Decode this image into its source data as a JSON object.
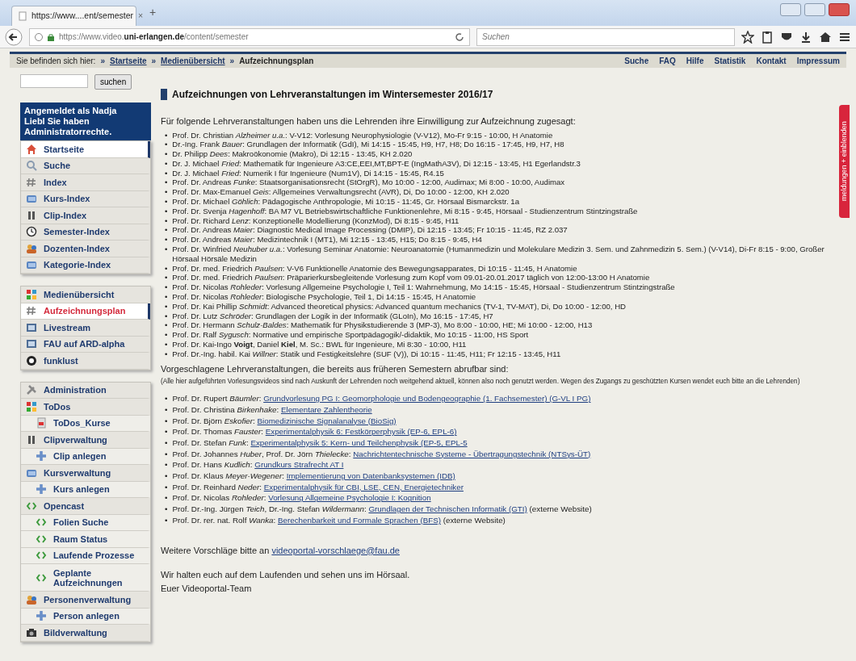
{
  "browser": {
    "tab_title": "https://www....ent/semester",
    "tab_close": "×",
    "new_tab": "+",
    "url": "https://www.video.**uni-erlangen.de**/content/semester",
    "search_placeholder": "Suchen"
  },
  "breadcrumb": {
    "prefix": "Sie befinden sich hier:",
    "items": [
      {
        "sep": "»",
        "label": "Startseite",
        "current": false
      },
      {
        "sep": "»",
        "label": "Medienübersicht",
        "current": false
      },
      {
        "sep": "»",
        "label": "Aufzeichnungsplan",
        "current": true
      }
    ]
  },
  "top_links": [
    "Suche",
    "FAQ",
    "Hilfe",
    "Statistik",
    "Kontakt",
    "Impressum"
  ],
  "sidebar": {
    "search_button": "suchen",
    "login_note": "Angemeldet als Nadja Liebl Sie haben Administratorrechte.",
    "groups": [
      [
        {
          "label": "Startseite",
          "selected": false,
          "highlighted": true
        },
        {
          "label": "Suche",
          "selected": false,
          "highlighted": false
        },
        {
          "label": "Index",
          "selected": false,
          "highlighted": false
        },
        {
          "label": "Kurs-Index",
          "selected": false,
          "highlighted": false
        },
        {
          "label": "Clip-Index",
          "selected": false,
          "highlighted": false
        },
        {
          "label": "Semester-Index",
          "selected": false,
          "highlighted": false
        },
        {
          "label": "Dozenten-Index",
          "selected": false,
          "highlighted": false
        },
        {
          "label": "Kategorie-Index",
          "selected": false,
          "highlighted": false
        }
      ],
      [
        {
          "label": "Medienübersicht",
          "selected": false,
          "highlighted": false
        },
        {
          "label": "Aufzeichnungsplan",
          "selected": true,
          "highlighted": true
        },
        {
          "label": "Livestream",
          "selected": false,
          "highlighted": false
        },
        {
          "label": "FAU auf ARD-alpha",
          "selected": false,
          "highlighted": false
        },
        {
          "label": "funklust",
          "selected": false,
          "highlighted": false
        }
      ],
      [
        {
          "label": "Administration",
          "selected": false,
          "highlighted": false
        },
        {
          "label": "ToDos",
          "selected": false,
          "highlighted": false,
          "children": [
            {
              "label": "ToDos_Kurse",
              "selected": false,
              "highlighted": false
            }
          ]
        },
        {
          "label": "Clipverwaltung",
          "selected": false,
          "highlighted": false,
          "children": [
            {
              "label": "Clip anlegen",
              "selected": false,
              "highlighted": false
            }
          ]
        },
        {
          "label": "Kursverwaltung",
          "selected": false,
          "highlighted": false,
          "children": [
            {
              "label": "Kurs anlegen",
              "selected": false,
              "highlighted": false
            }
          ]
        },
        {
          "label": "Opencast",
          "selected": false,
          "highlighted": false,
          "children": [
            {
              "label": "Folien Suche",
              "selected": false,
              "highlighted": false
            },
            {
              "label": "Raum Status",
              "selected": false,
              "highlighted": false
            },
            {
              "label": "Laufende Prozesse",
              "selected": false,
              "highlighted": false
            },
            {
              "label": "Geplante Aufzeichnungen",
              "selected": false,
              "highlighted": false
            }
          ]
        },
        {
          "label": "Personenverwaltung",
          "selected": false,
          "highlighted": false,
          "children": [
            {
              "label": "Person anlegen",
              "selected": false,
              "highlighted": false
            }
          ]
        },
        {
          "label": "Bildverwaltung",
          "selected": false,
          "highlighted": false
        }
      ]
    ]
  },
  "side_tab": "meldungen + einblenden",
  "main": {
    "title": "Aufzeichnungen von Lehrveranstaltungen im Wintersemester 2016/17",
    "intro": "Für folgende Lehrveranstaltungen haben uns die Lehrenden ihre Einwilligung zur Aufzeichnung zugesagt:",
    "current_courses": [
      {
        "bullet": "•",
        "text": "Prof. Dr. Christian *Alzheimer u.a.*: V-V12: Vorlesung Neurophysiologie (V-V12), Mo-Fr 9:15 - 10:00, H Anatomie"
      },
      {
        "bullet": "•",
        "text": "Dr.-Ing. Frank *Bauer*: Grundlagen der Informatik (GdI), Mi 14:15 - 15:45, H9, H7, H8; Do 16:15 - 17:45, H9, H7, H8"
      },
      {
        "bullet": "•",
        "text": "Dr. Philipp *Dees*: Makroökonomie (Makro), Di 12:15 - 13:45, KH 2.020"
      },
      {
        "bullet": "•",
        "text": "Dr. J. Michael *Fried*: Mathematik für Ingenieure A3:CE,EEI,MT,BPT-E (IngMathA3V), Di 12:15 - 13:45, H1 Egerlandstr.3"
      },
      {
        "bullet": "•",
        "text": "Dr. J. Michael *Fried*: Numerik I für Ingenieure (Num1V), Di 14:15 - 15:45, R4.15"
      },
      {
        "bullet": "•",
        "text": "Prof. Dr. Andreas *Funke*: Staatsorganisationsrecht (StOrgR), Mo 10:00 - 12:00, Audimax; Mi 8:00 - 10:00, Audimax"
      },
      {
        "bullet": "•",
        "text": "Prof. Dr. Max-Emanuel *Geis*: Allgemeines Verwaltungsrecht (AVR), Di, Do 10:00 - 12:00, KH 2.020"
      },
      {
        "bullet": "•",
        "text": "Prof. Dr. Michael *Göhlich*: Pädagogische Anthropologie, Mi 10:15 - 11:45, Gr. Hörsaal Bismarckstr. 1a"
      },
      {
        "bullet": "•",
        "text": "Prof. Dr. Svenja *Hagenhoff*: BA M7 VL Betriebswirtschaftliche Funktionenlehre, Mi 8:15 - 9:45, Hörsaal - Studienzentrum Stintzingstraße"
      },
      {
        "bullet": "•",
        "text": "Prof. Dr. Richard *Lenz*: Konzeptionelle Modellierung (KonzMod), Di 8:15 - 9:45, H11"
      },
      {
        "bullet": "•",
        "text": "Prof. Dr. Andreas *Maier*: Diagnostic Medical Image Processing (DMIP), Di 12:15 - 13:45; Fr 10:15 - 11:45, RZ 2.037"
      },
      {
        "bullet": "•",
        "text": "Prof. Dr. Andreas *Maier*: Medizintechnik I (MT1), Mi 12:15 - 13:45, H15; Do 8:15 - 9:45, H4"
      },
      {
        "bullet": "•",
        "text": "Prof. Dr. Winfried *Neuhuber u.a.*: Vorlesung Seminar Anatomie: Neuroanatomie (Humanmedizin und Molekulare Medizin 3. Sem. und Zahnmedizin 5. Sem.) (V-V14), Di-Fr 8:15 - 9:00, Großer Hörsaal Hörsäle Medizin"
      },
      {
        "bullet": "•",
        "text": "Prof. Dr. med. Friedrich *Paulsen*: V-V6 Funktionelle Anatomie des Bewegungsapparates,  Di 10:15 - 11:45, H Anatomie"
      },
      {
        "bullet": "•",
        "text": "Prof. Dr. med. Friedrich *Paulsen*: Präparierkursbegleitende Vorlesung zum Kopf vom 09.01-20.01.2017 täglich von 12:00-13:00 H Anatomie"
      },
      {
        "bullet": "•",
        "text": "Prof. Dr. Nicolas *Rohleder*: Vorlesung Allgemeine Psychologie I, Teil 1: Wahrnehmung, Mo 14:15 - 15:45, Hörsaal - Studienzentrum Stintzingstraße"
      },
      {
        "bullet": "•",
        "text": "Prof. Dr. Nicolas *Rohleder*: Biologische Psychologie, Teil 1, Di 14:15 - 15:45, H Anatomie"
      },
      {
        "bullet": "•",
        "text": "Prof. Dr. Kai Phillip *Schmidt*: Advanced theoretical physics: Advanced quantum mechanics (TV-1, TV-MAT), Di, Do 10:00 - 12:00, HD"
      },
      {
        "bullet": "•",
        "text": "Prof. Dr. Lutz *Schröder*: Grundlagen der Logik in der Informatik (GLoIn), Mo 16:15 - 17:45, H7"
      },
      {
        "bullet": "•",
        "text": "Prof. Dr. Hermann *Schulz-Baldes*: Mathematik für Physikstudierende 3 (MP-3), Mo 8:00 - 10:00, HE; Mi 10:00 - 12:00, H13"
      },
      {
        "bullet": "•",
        "text": "Prof. Dr. Ralf *Sygusch*: Normative und empirische Sportpädagogik/-didaktik, Mo 10:15 - 11:00, HS Sport"
      },
      {
        "bullet": "•",
        "text": "Prof. Dr. Kai-Ingo **Voigt**, Daniel **Kiel**, M. Sc.: BWL für Ingenieure, Mi 8:30 - 10:00, H11"
      },
      {
        "bullet": "•",
        "text": "Prof. Dr.-Ing. habil. Kai *Willner*: Statik und Festigkeitslehre (SUF (V)), Di 10:15 - 11:45, H11; Fr 12:15 - 13:45, H11"
      }
    ],
    "suggested_heading": "Vorgeschlagene Lehrveranstaltungen, die bereits aus früheren Semestern abrufbar sind:",
    "suggested_note": "(Alle hier aufgeführten Vorlesungsvideos sind nach Auskunft der Lehrenden noch weitgehend aktuell, können also noch genutzt werden. Wegen des Zugangs zu geschützten Kursen wendet euch bitte an die Lehrenden)",
    "suggested_courses": [
      {
        "bullet": "•",
        "text": "Prof. Dr. Rupert *Bäumler*:",
        "link": "Grundvorlesung PG I: Geomorphologie und Bodengeographie (1. Fachsemester) (G-VL I PG)"
      },
      {
        "bullet": "•",
        "text": "Prof. Dr. Christina *Birkenhake*:",
        "link": "Elementare Zahlentheorie"
      },
      {
        "bullet": "•",
        "text": "Prof. Dr. Björn *Eskofier*:",
        "link": "Biomedizinische Signalanalyse (BioSig)"
      },
      {
        "bullet": "•",
        "text": "Prof. Dr. Thomas *Fauster*:",
        "link": "Experimentalphysik 6: Festkörperphysik (EP-6, EPL-6)"
      },
      {
        "bullet": "•",
        "text": "Prof. Dr. Stefan *Funk*:",
        "link": "Experimentalphysik 5: Kern- und Teilchenphysik (EP-5, EPL-5"
      },
      {
        "bullet": "•",
        "text": "Prof. Dr. Johannes *Huber*, Prof. Dr. Jörn *Thielecke*:",
        "link": "Nachrichtentechnische Systeme - Übertragungstechnik (NTSys-ÜT)"
      },
      {
        "bullet": "•",
        "text": "Prof. Dr. Hans *Kudlich*:",
        "link": "Grundkurs Strafrecht AT I"
      },
      {
        "bullet": "•",
        "text": "Prof. Dr. Klaus *Meyer-Wegener*:",
        "link": "Implementierung von Datenbanksystemen (IDB)"
      },
      {
        "bullet": "•",
        "text": "Prof. Dr. Reinhard *Neder*:",
        "link": "Experimentalphysik für CBI, LSE, CEN, Energietechniker"
      },
      {
        "bullet": "•",
        "text": "Prof. Dr. Nicolas *Rohleder*:",
        "link": "Vorlesung Allgemeine Psychologie I: Kognition"
      },
      {
        "bullet": "•",
        "text": "Prof. Dr.-Ing. Jürgen *Teich*, Dr.-Ing. Stefan *Wildermann*:",
        "link": "Grundlagen der Technischen Informatik (GTI)",
        "suffix": "(externe Website)"
      },
      {
        "bullet": "•",
        "text": "Prof. Dr. rer. nat. Rolf *Wanka*:",
        "link": "Berechenbarkeit und Formale Sprachen (BFS)",
        "suffix": "(externe Website)"
      }
    ],
    "contact": {
      "text": "Weitere Vorschläge bitte an",
      "link": "videoportal-vorschlaege@fau.de"
    },
    "closing": [
      "Wir halten euch auf dem Laufenden und sehen uns im Hörsaal.",
      "Euer Videoportal-Team"
    ]
  }
}
